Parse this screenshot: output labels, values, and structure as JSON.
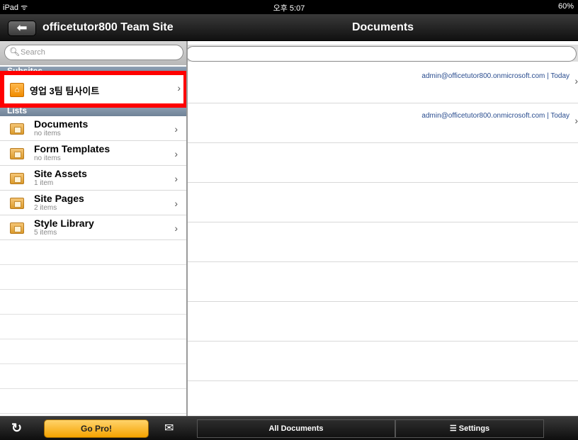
{
  "statusbar": {
    "device": "iPad ᯤ",
    "time": "오후 5:07",
    "battery": "60%"
  },
  "navbar": {
    "back_label": "officetutor800 Team Site",
    "title": "Documents"
  },
  "search": {
    "placeholder": "Search"
  },
  "sections": {
    "subsites": "Subsites",
    "lists": "Lists"
  },
  "subsites": [
    {
      "label": "영업 3팀 팀사이트"
    }
  ],
  "lists": [
    {
      "name": "Documents",
      "count": "no items"
    },
    {
      "name": "Form Templates",
      "count": "no items"
    },
    {
      "name": "Site Assets",
      "count": "1 item"
    },
    {
      "name": "Site Pages",
      "count": "2 items"
    },
    {
      "name": "Style Library",
      "count": "5 items"
    }
  ],
  "documents": [
    {
      "meta": "admin@officetutor800.onmicrosoft.com | Today"
    },
    {
      "meta": "admin@officetutor800.onmicrosoft.com | Today"
    }
  ],
  "toolbar": {
    "go_pro": "Go Pro!",
    "all_documents": "All Documents",
    "settings": "Settings"
  },
  "colors": {
    "highlight": "#ff0000",
    "gopro": "#f5a300",
    "link": "#2a4d8f"
  }
}
